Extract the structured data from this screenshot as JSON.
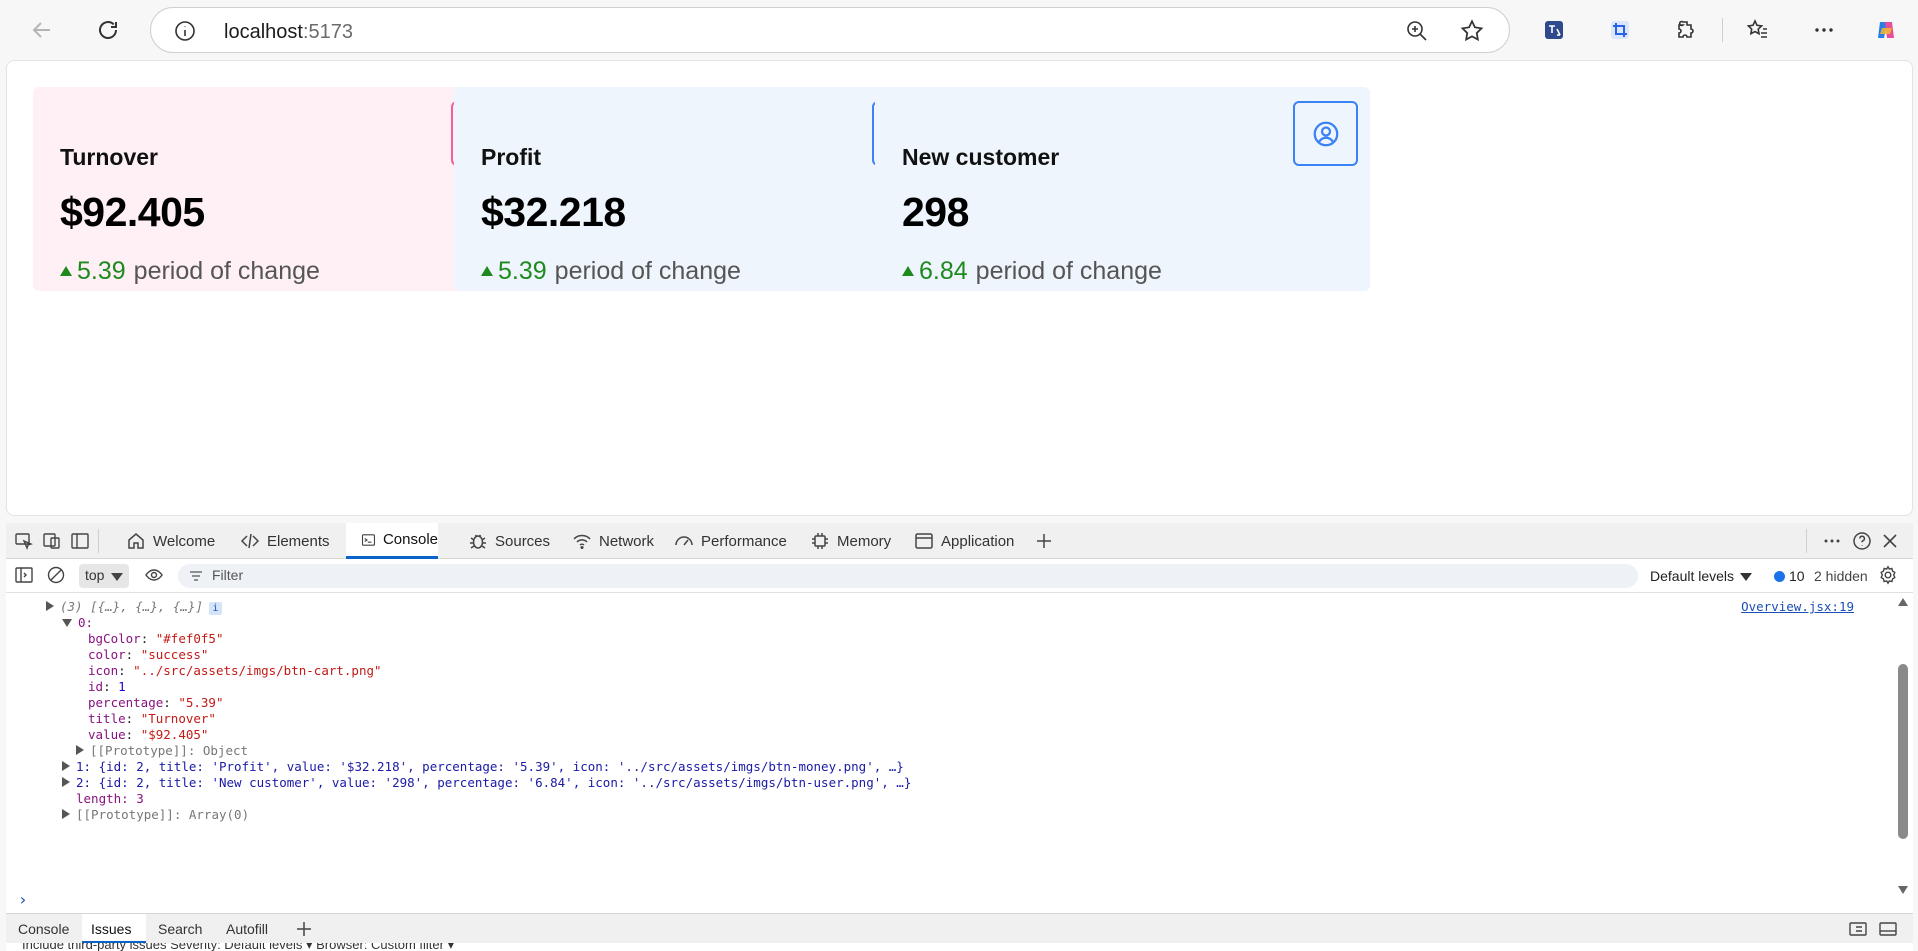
{
  "browser": {
    "url_host": "localhost",
    "url_port": ":5173"
  },
  "cards": [
    {
      "title": "Turnover",
      "value": "$92.405",
      "percentage": "5.39",
      "change_label": "period of change",
      "bg": "#fef0f5",
      "accent": "#f0609a",
      "icon": "cart-icon"
    },
    {
      "title": "Profit",
      "value": "$32.218",
      "percentage": "5.39",
      "change_label": "period of change",
      "bg": "#eef5fd",
      "accent": "#3b82f6",
      "icon": "dollar-icon"
    },
    {
      "title": "New customer",
      "value": "298",
      "percentage": "6.84",
      "change_label": "period of change",
      "bg": "#eef5fd",
      "accent": "#3b82f6",
      "icon": "user-icon"
    }
  ],
  "devtools": {
    "tabs": [
      {
        "label": "Welcome",
        "icon": "home-icon"
      },
      {
        "label": "Elements",
        "icon": "code-icon"
      },
      {
        "label": "Console",
        "icon": "console-icon"
      },
      {
        "label": "Sources",
        "icon": "bug-icon"
      },
      {
        "label": "Network",
        "icon": "wifi-icon"
      },
      {
        "label": "Performance",
        "icon": "speedometer-icon"
      },
      {
        "label": "Memory",
        "icon": "chip-icon"
      },
      {
        "label": "Application",
        "icon": "window-icon"
      }
    ],
    "context": "top",
    "filter_placeholder": "Filter",
    "levels": "Default levels",
    "message_count": "10",
    "hidden_count": "2 hidden",
    "source_link": "Overview.jsx:19",
    "log": {
      "summary": "(3) [{…}, {…}, {…}]",
      "item0_key": "0:",
      "item0": [
        {
          "key": "bgColor",
          "value": "\"#fef0f5\"",
          "kind": "string"
        },
        {
          "key": "color",
          "value": "\"success\"",
          "kind": "string"
        },
        {
          "key": "icon",
          "value": "\"../src/assets/imgs/btn-cart.png\"",
          "kind": "string"
        },
        {
          "key": "id",
          "value": "1",
          "kind": "number"
        },
        {
          "key": "percentage",
          "value": "\"5.39\"",
          "kind": "string"
        },
        {
          "key": "title",
          "value": "\"Turnover\"",
          "kind": "string"
        },
        {
          "key": "value",
          "value": "\"$92.405\"",
          "kind": "string"
        }
      ],
      "item0_proto": "[[Prototype]]: Object",
      "item1": "1: {id: 2, title: 'Profit', value: '$32.218', percentage: '5.39', icon: '../src/assets/imgs/btn-money.png', …}",
      "item2": "2: {id: 2, title: 'New customer', value: '298', percentage: '6.84', icon: '../src/assets/imgs/btn-user.png', …}",
      "length": "length: 3",
      "array_proto": "[[Prototype]]: Array(0)"
    },
    "drawer_tabs": [
      "Console",
      "Issues",
      "Search",
      "Autofill"
    ],
    "drawer_row": "Include third-party issues   Severity:   Default levels ▾    Browser:   Custom filter ▾"
  }
}
